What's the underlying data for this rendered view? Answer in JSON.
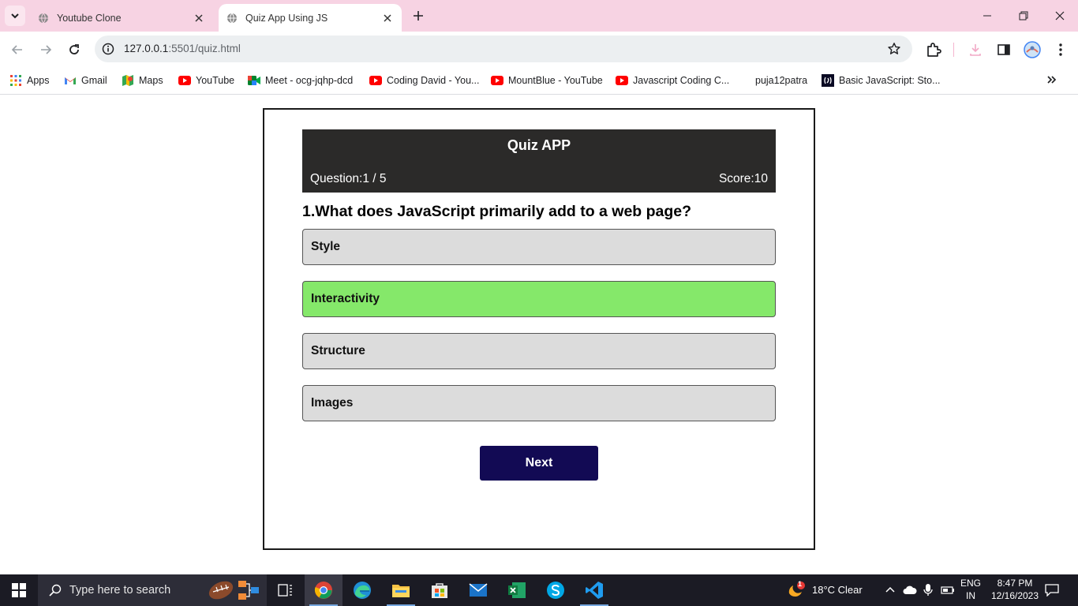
{
  "browser": {
    "tabs": [
      {
        "title": "Youtube Clone",
        "active": false
      },
      {
        "title": "Quiz App Using JS",
        "active": true
      }
    ],
    "url_host": "127.0.0.1",
    "url_rest": ":5501/quiz.html",
    "bookmarks": [
      {
        "label": "Apps",
        "icon": "apps-grid-icon"
      },
      {
        "label": "Gmail",
        "icon": "gmail-icon"
      },
      {
        "label": "Maps",
        "icon": "maps-icon"
      },
      {
        "label": "YouTube",
        "icon": "youtube-icon"
      },
      {
        "label": "Meet - ocg-jqhp-dcd",
        "icon": "meet-icon"
      },
      {
        "label": "Coding David - You...",
        "icon": "youtube-icon"
      },
      {
        "label": "MountBlue - YouTube",
        "icon": "youtube-icon"
      },
      {
        "label": "Javascript Coding C...",
        "icon": "youtube-icon"
      },
      {
        "label": "puja12patra",
        "icon": "none"
      },
      {
        "label": "Basic JavaScript: Sto...",
        "icon": "freecodecamp-icon"
      }
    ]
  },
  "quiz": {
    "title": "Quiz APP",
    "question_label": "Question:",
    "question_progress": "1 / 5",
    "score_label": "Score:",
    "score_value": "10",
    "question": "1.What does JavaScript primarily add to a web page?",
    "options": [
      {
        "text": "Style",
        "state": "default"
      },
      {
        "text": "Interactivity",
        "state": "correct"
      },
      {
        "text": "Structure",
        "state": "default"
      },
      {
        "text": "Images",
        "state": "default"
      }
    ],
    "next_label": "Next",
    "colors": {
      "header_bg": "#2b2a29",
      "option_bg": "#dcdcdc",
      "correct_bg": "#85e86a",
      "next_bg": "#120a54"
    }
  },
  "taskbar": {
    "search_placeholder": "Type here to search",
    "weather_badge": "1",
    "weather": "18°C  Clear",
    "lang_line1": "ENG",
    "lang_line2": "IN",
    "time": "8:47 PM",
    "date": "12/16/2023"
  }
}
